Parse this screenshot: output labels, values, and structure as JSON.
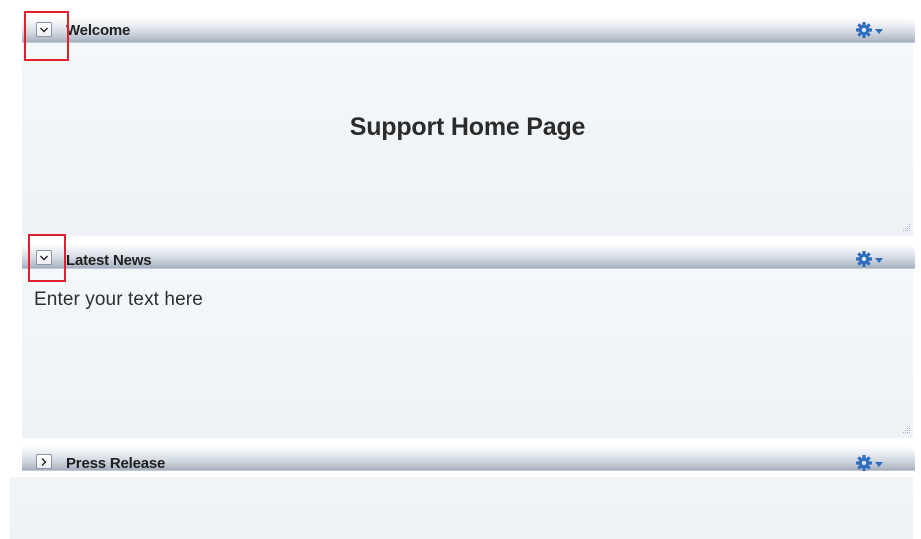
{
  "panels": [
    {
      "title": "Welcome",
      "expanded": true,
      "toggle_icon": "chevron-down-icon",
      "menu_icon": "gear-icon",
      "content_heading": "Support Home Page"
    },
    {
      "title": "Latest News",
      "expanded": true,
      "toggle_icon": "chevron-down-icon",
      "menu_icon": "gear-icon",
      "content_text": "Enter your text here"
    },
    {
      "title": "Press Release",
      "expanded": false,
      "toggle_icon": "chevron-right-icon",
      "menu_icon": "gear-icon"
    }
  ],
  "colors": {
    "highlight": "#e0202a",
    "gear": "#2f6dbf",
    "header_dark": "#a3acbb",
    "body_bg": "#f5f8fa"
  }
}
